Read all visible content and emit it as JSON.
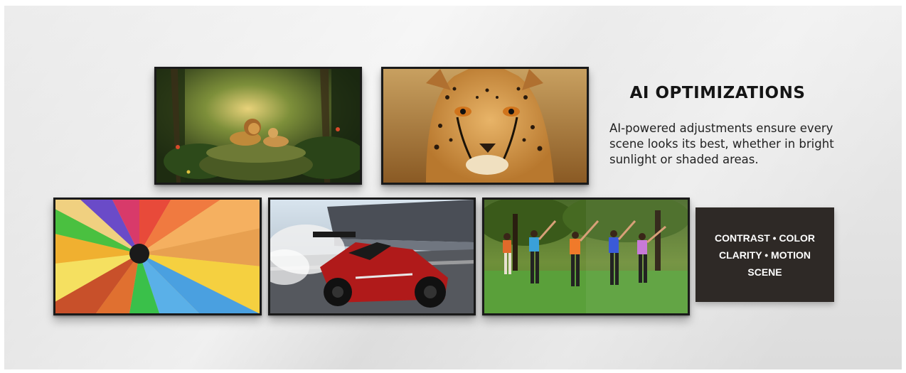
{
  "heading": "AI OPTIMIZATIONS",
  "description": "AI-powered adjustments ensure every scene looks its best, whether in bright sunlight or shaded areas.",
  "features": {
    "line1": "CONTRAST • COLOR",
    "line2": "CLARITY • MOTION",
    "line3": "SCENE"
  },
  "colors": {
    "feature_box_bg": "#2e2926",
    "heading_text": "#151515"
  }
}
